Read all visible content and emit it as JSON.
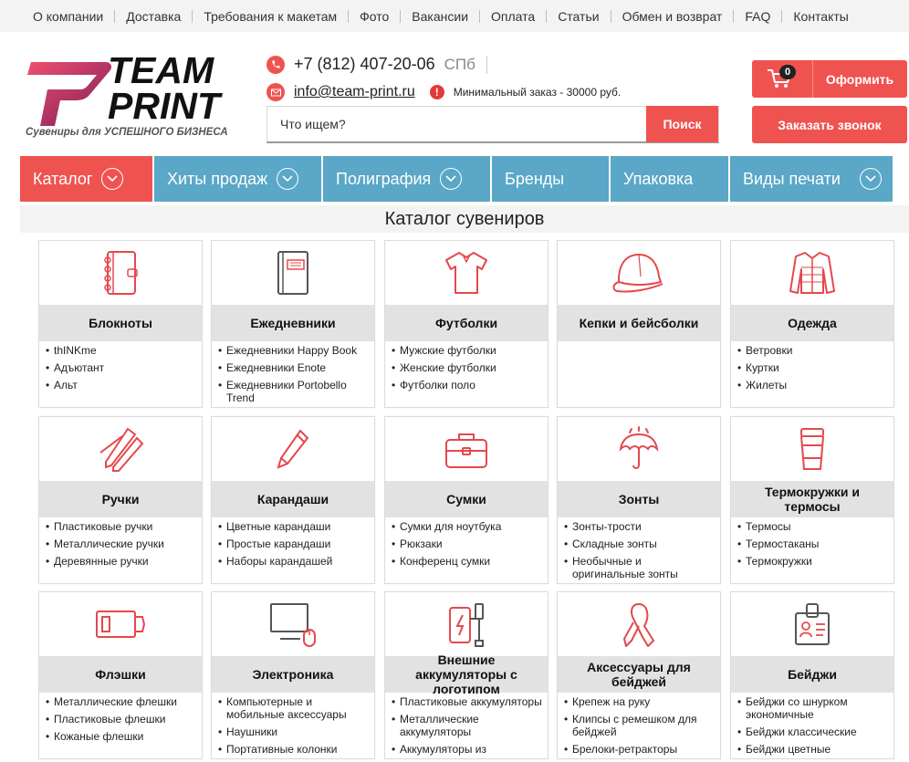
{
  "topnav": [
    "О компании",
    "Доставка",
    "Требования к макетам",
    "Фото",
    "Вакансии",
    "Оплата",
    "Статьи",
    "Обмен и возврат",
    "FAQ",
    "Контакты"
  ],
  "logo": {
    "line1": "TEAM",
    "line2": "PRINT",
    "slogan": "Сувениры для УСПЕШНОГО БИЗНЕСА"
  },
  "contacts": {
    "phone": "+7 (812) 407-20-06",
    "city": "СПб",
    "email": "info@team-print.ru",
    "min_order": "Минимальный заказ - 30000 руб."
  },
  "search": {
    "placeholder": "Что ищем?",
    "button": "Поиск"
  },
  "cart": {
    "count": "0",
    "label": "Оформить"
  },
  "call_button": "Заказать звонок",
  "mainnav": [
    {
      "label": "Каталог",
      "dropdown": true,
      "active": true
    },
    {
      "label": "Хиты продаж",
      "dropdown": true
    },
    {
      "label": "Полиграфия",
      "dropdown": true
    },
    {
      "label": "Бренды",
      "dropdown": false
    },
    {
      "label": "Упаковка",
      "dropdown": false
    },
    {
      "label": "Виды печати",
      "dropdown": true
    }
  ],
  "section_title": "Каталог сувениров",
  "colors": {
    "accent": "#ef5350",
    "nav": "#5aa7c7",
    "title_bg": "#e2e2e2"
  },
  "categories": [
    {
      "title": "Блокноты",
      "icon": "notebook-icon",
      "items": [
        "thINKme",
        "Адъютант",
        "Альт"
      ]
    },
    {
      "title": "Ежедневники",
      "icon": "diary-icon",
      "items": [
        "Ежедневники Happy Book",
        "Ежедневники Enote",
        "Ежедневники Portobello Trend"
      ]
    },
    {
      "title": "Футболки",
      "icon": "tshirt-icon",
      "items": [
        "Мужские футболки",
        "Женские футболки",
        "Футболки поло"
      ]
    },
    {
      "title": "Кепки и бейсболки",
      "icon": "cap-icon",
      "items": []
    },
    {
      "title": "Одежда",
      "icon": "jacket-icon",
      "items": [
        "Ветровки",
        "Куртки",
        "Жилеты"
      ]
    },
    {
      "title": "Ручки",
      "icon": "pens-icon",
      "items": [
        "Пластиковые ручки",
        "Металлические ручки",
        "Деревянные ручки"
      ]
    },
    {
      "title": "Карандаши",
      "icon": "pencil-icon",
      "items": [
        "Цветные карандаши",
        "Простые карандаши",
        "Наборы карандашей"
      ]
    },
    {
      "title": "Сумки",
      "icon": "bag-icon",
      "items": [
        "Сумки для ноутбука",
        "Рюкзаки",
        "Конференц сумки"
      ]
    },
    {
      "title": "Зонты",
      "icon": "umbrella-icon",
      "items": [
        "Зонты-трости",
        "Складные зонты",
        "Необычные и оригинальные зонты"
      ]
    },
    {
      "title": "Термокружки и термосы",
      "icon": "thermo-cup-icon",
      "items": [
        "Термосы",
        "Термостаканы",
        "Термокружки"
      ]
    },
    {
      "title": "Флэшки",
      "icon": "flash-drive-icon",
      "items": [
        "Металлические флешки",
        "Пластиковые флешки",
        "Кожаные флешки"
      ]
    },
    {
      "title": "Электроника",
      "icon": "computer-icon",
      "items": [
        "Компьютерные и мобильные аксессуары",
        "Наушники",
        "Портативные колонки"
      ]
    },
    {
      "title": "Внешние аккумуляторы с логотипом",
      "icon": "powerbank-icon",
      "items": [
        "Пластиковые аккумуляторы",
        "Металлические аккумуляторы",
        "Аккумуляторы из"
      ]
    },
    {
      "title": "Аксессуары для бейджей",
      "icon": "ribbon-icon",
      "items": [
        "Крепеж на руку",
        "Клипсы с ремешком для бейджей",
        "Брелоки-ретракторы"
      ]
    },
    {
      "title": "Бейджи",
      "icon": "badge-icon",
      "items": [
        "Бейджи со шнурком экономичные",
        "Бейджи классические",
        "Бейджи цветные"
      ]
    }
  ]
}
